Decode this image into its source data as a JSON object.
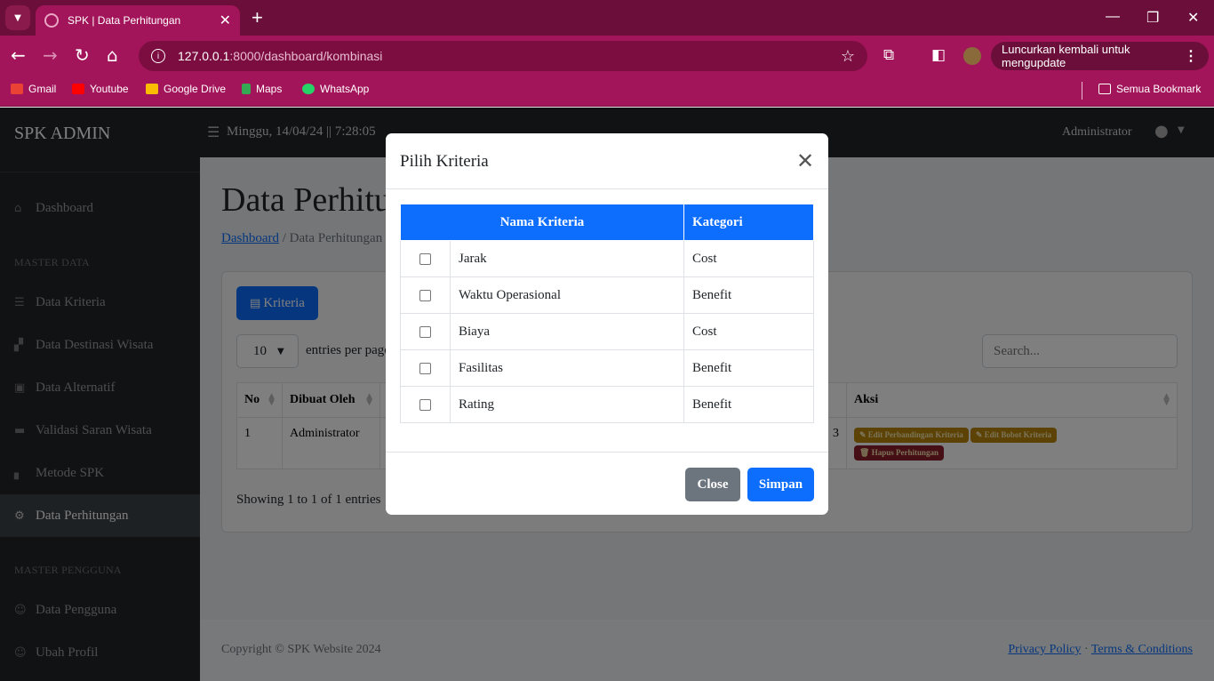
{
  "browser": {
    "tab_title": "SPK | Data Perhitungan",
    "url_host": "127.0.0.1",
    "url_rest": ":8000/dashboard/kombinasi",
    "relaunch": "Luncurkan kembali untuk mengupdate",
    "bookmarks": [
      "Gmail",
      "Youtube",
      "Google Drive",
      "Maps",
      "WhatsApp"
    ],
    "all_bookmarks": "Semua Bookmark",
    "colors": {
      "frame": "#6b0f3a",
      "toolbar": "#a3155a"
    }
  },
  "sidebar": {
    "brand": "SPK ADMIN",
    "dashboard": "Dashboard",
    "section_master": "MASTER DATA",
    "items": [
      "Data Kriteria",
      "Data Destinasi Wisata",
      "Data Alternatif",
      "Validasi Saran Wisata",
      "Metode SPK",
      "Data Perhitungan"
    ],
    "section_user": "MASTER PENGGUNA",
    "user_items": [
      "Data Pengguna",
      "Ubah Profil"
    ]
  },
  "topnav": {
    "datetime": "Minggu, 14/04/24 || 7:28:05",
    "user": "Administrator"
  },
  "main": {
    "title": "Data Perhitungan",
    "breadcrumb_home": "Dashboard",
    "breadcrumb_current": "Data Perhitungan",
    "btn_kriteria": "Kriteria",
    "entries_value": "10",
    "entries_label": "entries per page",
    "search_placeholder": "Search...",
    "columns": [
      "No",
      "Dibuat Oleh",
      "Aksi"
    ],
    "row": {
      "no": "1",
      "dibuat_oleh": "Administrator",
      "partial": "3"
    },
    "actions": [
      "Edit Perbandingan Kriteria",
      "Edit Bobot Kriteria",
      "Hapus Perhitungan"
    ],
    "showing": "Showing 1 to 1 of 1 entries"
  },
  "footer": {
    "copyright": "Copyright © SPK Website 2024",
    "privacy": "Privacy Policy",
    "sep": "·",
    "terms": "Terms & Conditions"
  },
  "modal": {
    "title": "Pilih Kriteria",
    "col_name": "Nama Kriteria",
    "col_kategori": "Kategori",
    "rows": [
      {
        "name": "Jarak",
        "kategori": "Cost"
      },
      {
        "name": "Waktu Operasional",
        "kategori": "Benefit"
      },
      {
        "name": "Biaya",
        "kategori": "Cost"
      },
      {
        "name": "Fasilitas",
        "kategori": "Benefit"
      },
      {
        "name": "Rating",
        "kategori": "Benefit"
      }
    ],
    "close": "Close",
    "save": "Simpan"
  }
}
